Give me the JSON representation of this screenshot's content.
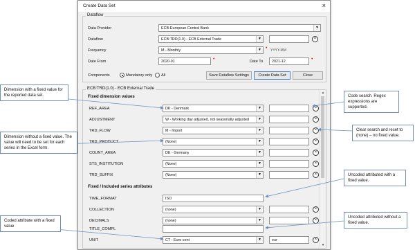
{
  "dialog": {
    "title": "Create Data Set",
    "close_glyph": "×",
    "dataflow_group": {
      "legend": "Dataflow",
      "rows": [
        {
          "label": "Data Provider",
          "value": "ECB-European Central Bank"
        },
        {
          "label": "Dataflow",
          "value": "ECB:TRD(1.0) - ECB External Trade"
        },
        {
          "label": "Frequency",
          "value": "M - Monthly",
          "hint": "YYYY-MM"
        },
        {
          "label": "Date From",
          "value": "2020-01",
          "to_label": "Date To",
          "to_value": "2021-12"
        }
      ],
      "components_label": "Components",
      "radio_mandatory": "Mandatory only",
      "radio_all": "All",
      "buttons": {
        "save": "Save Dataflow Settings",
        "create": "Create Data Set",
        "close": "Close"
      }
    },
    "dimensions_group": {
      "legend": "ECB:TRD(1.0) - ECB External Trade",
      "fixed_dimensions_title": "Fixed dimension values",
      "dimensions": [
        {
          "label": "REF_AREA",
          "value": "DK - Denmark"
        },
        {
          "label": "ADJUSTMENT",
          "value": "W - Working day adjusted, not seasonally adjusted"
        },
        {
          "label": "TRD_FLOW",
          "value": "M - Import"
        },
        {
          "label": "TRD_PRODUCT",
          "value": "(None)"
        },
        {
          "label": "COUNT_AREA",
          "value": "DE - Germany"
        },
        {
          "label": "STS_INSTITUTION",
          "value": "(None)"
        },
        {
          "label": "TRD_SUFFIX",
          "value": "(None)"
        }
      ],
      "attributes_title": "Fixed / Included series attributes",
      "attributes": [
        {
          "label": "TIME_FORMAT",
          "value": "ISO",
          "kind": "text"
        },
        {
          "label": "COLLECTION",
          "value": "(none)",
          "kind": "combo"
        },
        {
          "label": "DECIMALS",
          "value": "(none)",
          "kind": "combo"
        },
        {
          "label": "TITLE_COMPL",
          "value": "",
          "kind": "text"
        },
        {
          "label": "UNIT",
          "value": "CT - Euro cent",
          "kind": "combo",
          "search": "eur"
        }
      ]
    }
  },
  "callouts": {
    "fixed_dimension": "Dimension with a fixed value for the reported data set.",
    "code_search": "Code search. Regex expressions are supported.",
    "dimension_without": "Dimension without a fixed value. The value will need to be set for each series in the Excel form.",
    "clear_search": "Clear search and reset to (none) – no fixed value.",
    "uncoded_fixed": "Uncoded attributed with a fixed value.",
    "uncoded_without": "Uncoded attributed without a fixed value.",
    "coded_attribute": "Coded attribute with a fixed value"
  },
  "colors": {
    "callout_border": "#6f8fb8",
    "arrow": "#6c8ebf",
    "required": "#e02020",
    "primary_border": "#3c7fd6"
  }
}
